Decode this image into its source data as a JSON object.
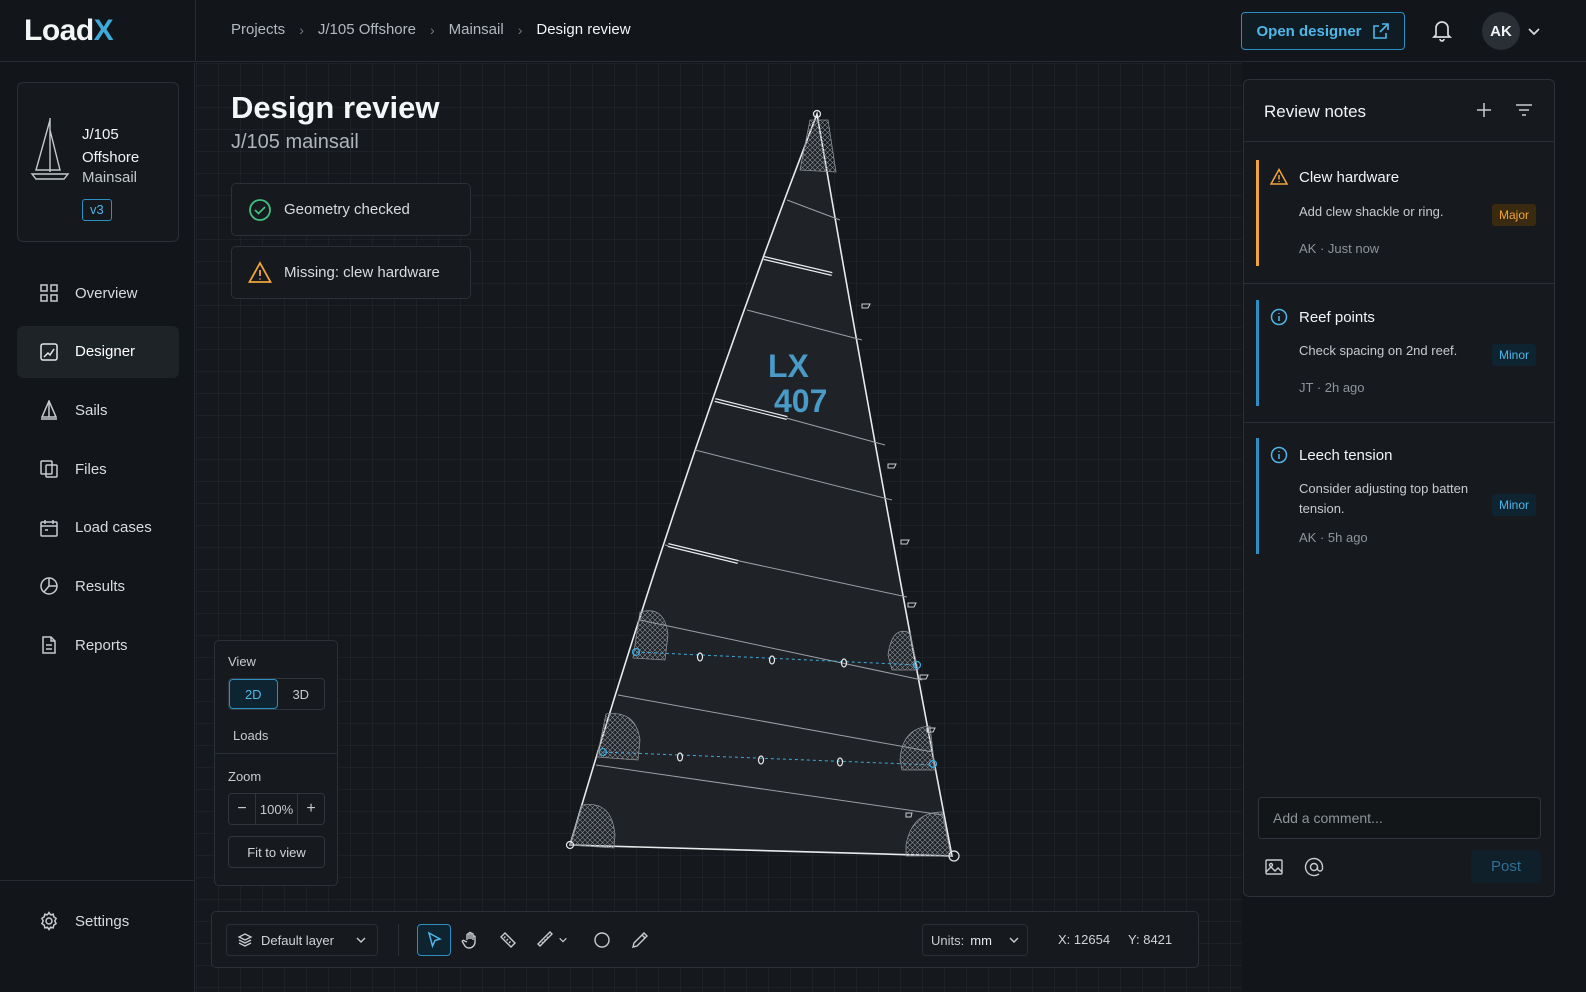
{
  "app": {
    "logo_main": "Load",
    "logo_accent": "X",
    "accent_color": "#3fa9d9"
  },
  "breadcrumb": [
    "Projects",
    "J/105 Offshore",
    "Mainsail",
    "Design review"
  ],
  "header": {
    "open_designer_label": "Open designer",
    "avatar_initials": "AK"
  },
  "project": {
    "name": "J/105 Offshore",
    "sail": "Mainsail",
    "version": "v3"
  },
  "sidebar": {
    "items": [
      {
        "label": "Overview",
        "icon": "grid-icon"
      },
      {
        "label": "Designer",
        "icon": "designer-icon",
        "active": true
      },
      {
        "label": "Sails",
        "icon": "sail-icon"
      },
      {
        "label": "Files",
        "icon": "files-icon"
      },
      {
        "label": "Load cases",
        "icon": "calendar-icon"
      },
      {
        "label": "Results",
        "icon": "results-icon"
      },
      {
        "label": "Reports",
        "icon": "report-icon"
      }
    ],
    "settings_label": "Settings"
  },
  "main": {
    "title": "Design review",
    "subtitle": "J/105 mainsail",
    "checks": [
      {
        "label": "Geometry checked",
        "status": "ok",
        "color": "#3fbf7f"
      },
      {
        "label": "Missing: clew hardware",
        "status": "warning",
        "color": "#f0a53a"
      }
    ],
    "sail_number_line1": "LX",
    "sail_number_line2": "407"
  },
  "view_panel": {
    "view_label": "View",
    "modes": [
      "2D",
      "3D"
    ],
    "active_mode": "2D",
    "loads_label": "Loads",
    "zoom_label": "Zoom",
    "zoom_value": "100%",
    "zoom_minus": "−",
    "zoom_plus": "+",
    "fit_label": "Fit to view"
  },
  "toolbar": {
    "layer": "Default layer",
    "units_label": "Units:",
    "units_value": "mm",
    "x_label": "X: 12654",
    "y_label": "Y: 8421",
    "tools": [
      "select-tool-icon",
      "pan-tool-icon",
      "measure-tool-icon",
      "ruler-tool-icon",
      "circle-tool-icon",
      "pencil-tool-icon"
    ]
  },
  "review_notes": {
    "title": "Review notes",
    "notes": [
      {
        "title": "Clew hardware",
        "body": "Add clew shackle or ring.",
        "meta": "AK · Just now",
        "severity": "Major",
        "icon": "warning-icon"
      },
      {
        "title": "Reef points",
        "body": "Check spacing on 2nd reef.",
        "meta": "JT · 2h ago",
        "severity": "Minor",
        "icon": "info-icon"
      },
      {
        "title": "Leech tension",
        "body": "Consider adjusting top batten tension.",
        "meta": "AK · 5h ago",
        "severity": "Minor",
        "icon": "info-icon"
      }
    ],
    "comment_placeholder": "Add a comment...",
    "post_label": "Post"
  }
}
